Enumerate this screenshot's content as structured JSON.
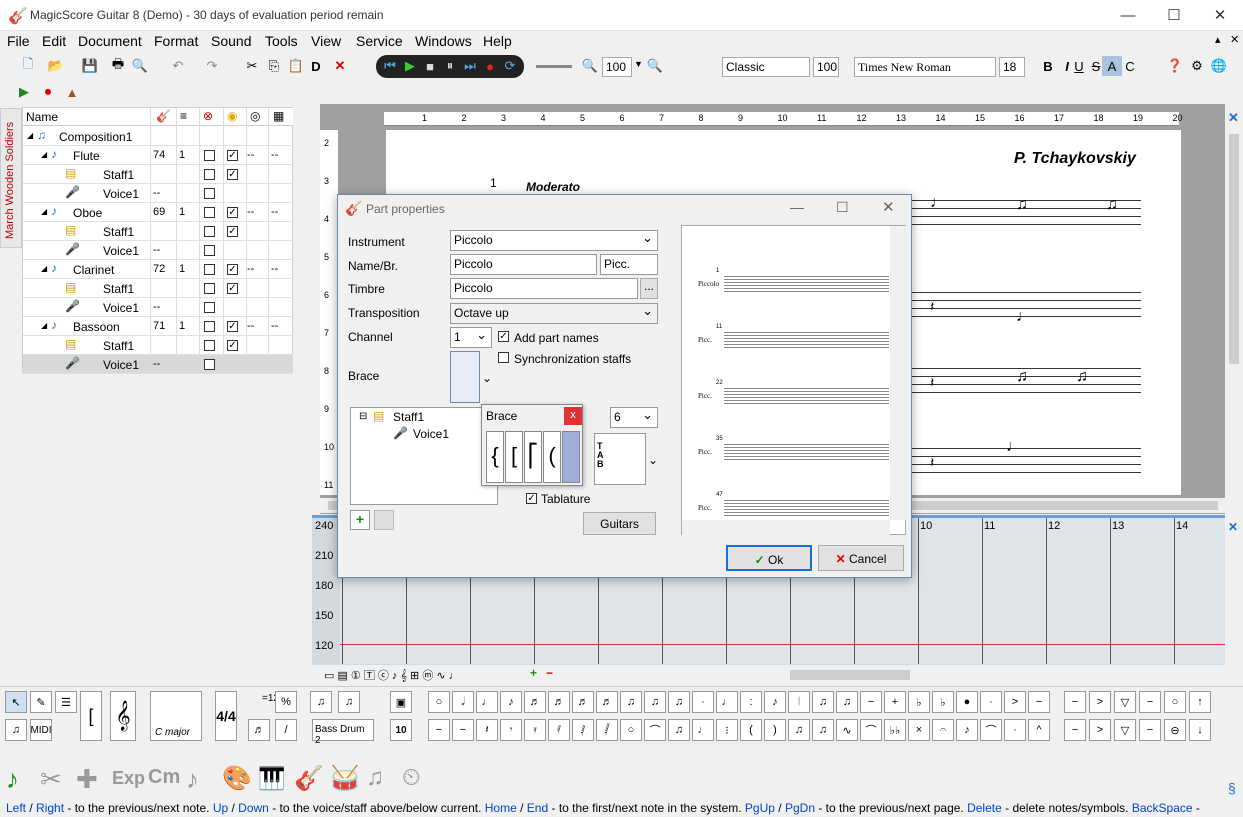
{
  "window": {
    "title": "MagicScore Guitar 8 (Demo) - 30 days of evaluation period remain"
  },
  "menu": [
    "File",
    "Edit",
    "Document",
    "Format",
    "Sound",
    "Tools",
    "View",
    "Service",
    "Windows",
    "Help"
  ],
  "toolbar": {
    "zoom": "100",
    "style": "Classic",
    "style_zoom": "100",
    "font": "Times New Roman",
    "font_size": "18",
    "bold": "B",
    "italic": "I",
    "underline": "U",
    "strike": "S",
    "a_label": "A",
    "c_label": "C",
    "d_label": "D"
  },
  "side_tab": "March Wooden Soldiers",
  "tree": {
    "header_name": "Name",
    "rows": [
      {
        "name": "Composition1",
        "c1": "",
        "c2": "",
        "cb1": "",
        "cb2": "",
        "d1": "",
        "d2": ""
      },
      {
        "name": "Flute",
        "c1": "74",
        "c2": "1",
        "cb1": "",
        "cb2": "✓",
        "d1": "--",
        "d2": "--"
      },
      {
        "name": "Staff1",
        "c1": "",
        "c2": "",
        "cb1": "",
        "cb2": "✓",
        "d1": "",
        "d2": ""
      },
      {
        "name": "Voice1",
        "c1": "--",
        "c2": "",
        "cb1": "",
        "cb2": "",
        "d1": "",
        "d2": ""
      },
      {
        "name": "Oboe",
        "c1": "69",
        "c2": "1",
        "cb1": "",
        "cb2": "✓",
        "d1": "--",
        "d2": "--"
      },
      {
        "name": "Staff1",
        "c1": "",
        "c2": "",
        "cb1": "",
        "cb2": "✓",
        "d1": "",
        "d2": ""
      },
      {
        "name": "Voice1",
        "c1": "--",
        "c2": "",
        "cb1": "",
        "cb2": "",
        "d1": "",
        "d2": ""
      },
      {
        "name": "Clarinet",
        "c1": "72",
        "c2": "1",
        "cb1": "",
        "cb2": "✓",
        "d1": "--",
        "d2": "--"
      },
      {
        "name": "Staff1",
        "c1": "",
        "c2": "",
        "cb1": "",
        "cb2": "✓",
        "d1": "",
        "d2": ""
      },
      {
        "name": "Voice1",
        "c1": "--",
        "c2": "",
        "cb1": "",
        "cb2": "",
        "d1": "",
        "d2": ""
      },
      {
        "name": "Bassoon",
        "c1": "71",
        "c2": "1",
        "cb1": "",
        "cb2": "✓",
        "d1": "--",
        "d2": "--"
      },
      {
        "name": "Staff1",
        "c1": "",
        "c2": "",
        "cb1": "",
        "cb2": "✓",
        "d1": "",
        "d2": ""
      },
      {
        "name": "Voice1",
        "c1": "--",
        "c2": "",
        "cb1": "",
        "cb2": "",
        "d1": "",
        "d2": ""
      }
    ]
  },
  "ruler": [
    "1",
    "2",
    "3",
    "4",
    "5",
    "6",
    "7",
    "8",
    "9",
    "10",
    "11",
    "12",
    "13",
    "14",
    "15",
    "16",
    "17",
    "18",
    "19",
    "20"
  ],
  "vruler": [
    "2",
    "3",
    "4",
    "5",
    "6",
    "7",
    "8",
    "9",
    "10",
    "11"
  ],
  "score": {
    "composer": "P. Tchaykovskiy",
    "tempo": "Moderato",
    "measure": "1"
  },
  "pianoroll": {
    "values": [
      "240",
      "210",
      "180",
      "150",
      "120"
    ],
    "measures": [
      "10",
      "11",
      "12",
      "13",
      "14"
    ]
  },
  "dialog": {
    "title": "Part properties",
    "instrument_label": "Instrument",
    "instrument": "Piccolo",
    "name_label": "Name/Br.",
    "name": "Piccolo",
    "short_name": "Picc.",
    "timbre_label": "Timbre",
    "timbre": "Piccolo",
    "timbre_more": "...",
    "transposition_label": "Transposition",
    "transposition": "Octave up",
    "channel_label": "Channel",
    "channel": "1",
    "add_part_names": "Add part names",
    "sync_staffs": "Synchronization staffs",
    "brace_label": "Brace",
    "tree_staff": "Staff1",
    "tree_voice": "Voice1",
    "lines": "6",
    "tablature": "Tablature",
    "guitars": "Guitars",
    "ok": "Ok",
    "cancel": "Cancel",
    "preview": {
      "first": "Piccolo",
      "abbr": "Picc.",
      "bars": [
        "1",
        "11",
        "22",
        "35",
        "47"
      ]
    }
  },
  "brace_popup": {
    "title": "Brace",
    "close": "x"
  },
  "palette": {
    "key": "C major",
    "instrument": "Bass Drum 2",
    "midi": "MIDI",
    "tempo": "=120",
    "num": "10"
  },
  "status": [
    {
      "k": "Left",
      "t": " / "
    },
    {
      "k": "Right",
      "t": " - to the previous/next note. "
    },
    {
      "k": "Up",
      "t": " / "
    },
    {
      "k": "Down",
      "t": " - to the voice/staff above/below current. "
    },
    {
      "k": "Home",
      "t": " / "
    },
    {
      "k": "End",
      "t": " - to the first/next note in the system. "
    },
    {
      "k": "PgUp",
      "t": " / "
    },
    {
      "k": "PgDn",
      "t": " - to the previous/next page. "
    },
    {
      "k": "Delete",
      "t": " - delete notes/symbols. "
    },
    {
      "k": "BackSpace",
      "t": " -"
    }
  ],
  "colors": {
    "accent": "#6a9fd4",
    "status_key": "#0044cc"
  }
}
